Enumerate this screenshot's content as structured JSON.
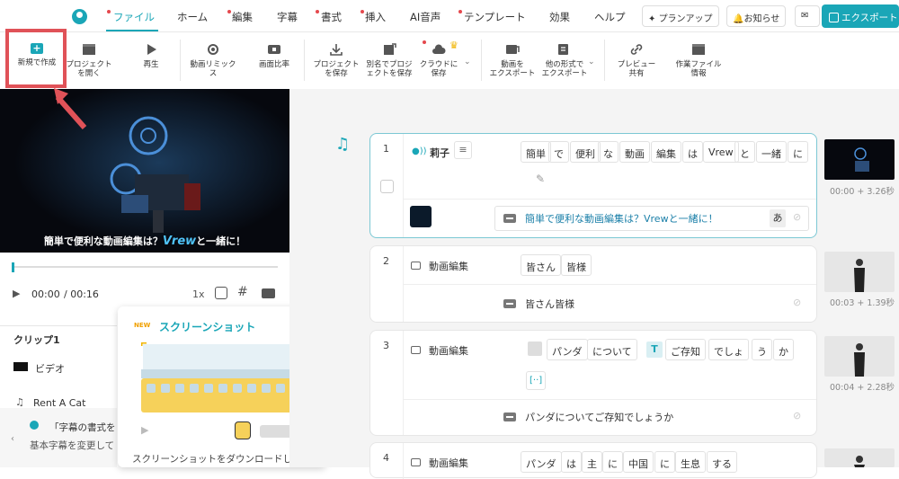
{
  "menubar": {
    "items": [
      "ファイル",
      "ホーム",
      "編集",
      "字幕",
      "書式",
      "挿入",
      "AI音声",
      "テンプレート",
      "効果",
      "ヘルプ"
    ],
    "plan_up": "プランアップ",
    "notice": "お知らせ",
    "export": "エクスポート"
  },
  "toolbar": {
    "new": "新規で作成",
    "open": [
      "プロジェクト",
      "を開く"
    ],
    "play": "再生",
    "remix": [
      "動画リミック",
      "ス"
    ],
    "ratio": "画面比率",
    "save": [
      "プロジェクト",
      "を保存"
    ],
    "save_as": [
      "別名でプロジ",
      "ェクトを保存"
    ],
    "cloud": [
      "クラウドに",
      "保存"
    ],
    "export_video": [
      "動画を",
      "エクスポート"
    ],
    "export_other": [
      "他の形式で",
      "エクスポート"
    ],
    "preview": [
      "プレビュー",
      "共有"
    ],
    "workfile": [
      "作業ファイル",
      "情報"
    ]
  },
  "player": {
    "subtitle_prefix": "簡単で便利な動画編集は？",
    "subtitle_brand": "Vrew",
    "subtitle_suffix": "と一緒に！",
    "time_current": "00:00",
    "time_total": "/ 00:16",
    "speed": "1x",
    "progress": 0.0
  },
  "clip_panel": {
    "title": "クリップ1",
    "video": "ビデオ",
    "music": "Rent A Cat",
    "tip_title": "「字幕の書式を",
    "tip_body": "基本字幕を変更して"
  },
  "popup": {
    "badge": "NEW",
    "title": "スクリーンショット",
    "body": "スクリーンショットをダウンロードし"
  },
  "clips": [
    {
      "num": "1",
      "speaker": "莉子",
      "words": [
        "簡単",
        "で",
        "便利",
        "な",
        "動画",
        "編集",
        "は",
        "Vrew",
        "と",
        "一緒",
        "に"
      ],
      "subtitle": "簡単で便利な動画編集は？Vrewと一緒に！",
      "kana": "あ",
      "time": "00:00 + 3.26秒"
    },
    {
      "num": "2",
      "speaker": "動画編集",
      "words": [
        "皆さん",
        "皆様"
      ],
      "subtitle": "皆さん皆様",
      "time": "00:03 + 1.39秒"
    },
    {
      "num": "3",
      "speaker": "動画編集",
      "words": [
        "パンダ",
        "について",
        "ご存知",
        "でしょ",
        "う",
        "か"
      ],
      "extra": "[··]",
      "t_icon": "T",
      "subtitle": "パンダについてご存知でしょうか",
      "time": "00:04 + 2.28秒"
    },
    {
      "num": "4",
      "speaker": "動画編集",
      "words": [
        "パンダ",
        "は",
        "主",
        "に",
        "中国",
        "に",
        "生息",
        "する"
      ]
    }
  ],
  "colors": {
    "accent": "#1aa6b7",
    "highlight": "#e05258"
  }
}
